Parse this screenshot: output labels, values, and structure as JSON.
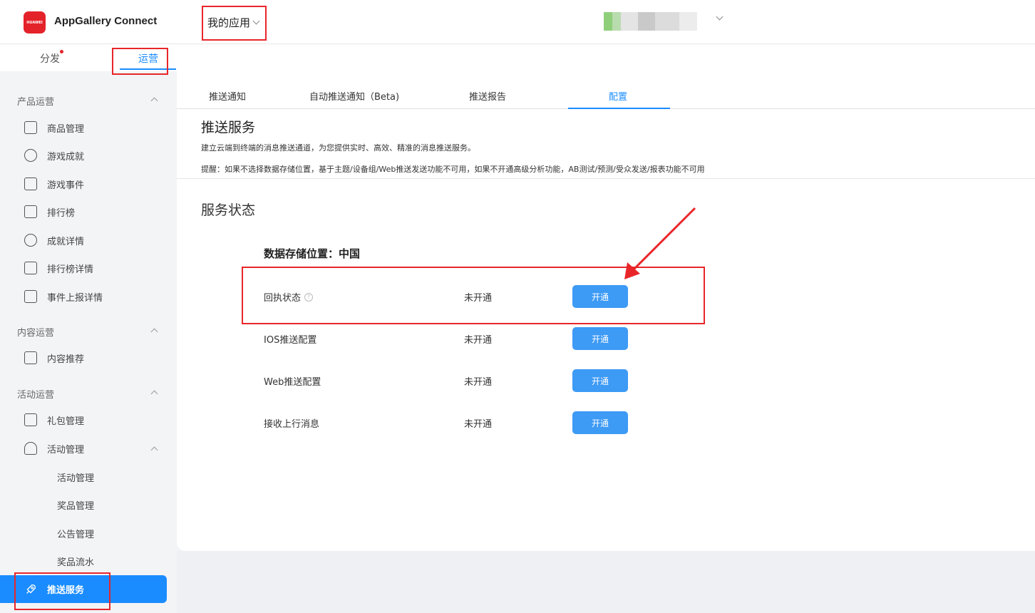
{
  "header": {
    "logo_text": "HUAWEI",
    "brand": "AppGallery Connect",
    "my_apps": "我的应用"
  },
  "subtabs": [
    {
      "label": "分发"
    },
    {
      "label": "运营"
    }
  ],
  "sidebar": {
    "sections": [
      {
        "title": "产品运营",
        "items": [
          "商品管理",
          "游戏成就",
          "游戏事件",
          "排行榜",
          "成就详情",
          "排行榜详情",
          "事件上报详情"
        ]
      },
      {
        "title": "内容运营",
        "items": [
          "内容推荐"
        ]
      },
      {
        "title": "活动运营",
        "items": [
          "礼包管理",
          "活动管理"
        ]
      }
    ],
    "activity_sub": [
      "活动管理",
      "奖品管理",
      "公告管理",
      "奖品流水"
    ],
    "active_item": "推送服务"
  },
  "main": {
    "tabs": [
      "推送通知",
      "自动推送通知（Beta)",
      "推送报告",
      "配置"
    ],
    "title": "推送服务",
    "description": "建立云端到终端的消息推送通道，为您提供实时、高效、精准的消息推送服务。",
    "tip": "提醒：如果不选择数据存储位置，基于主题/设备组/Web推送发送功能不可用，如果不开通高级分析功能，AB测试/预测/受众发送/报表功能不可用",
    "status_title": "服务状态",
    "storage_location": "数据存储位置：中国",
    "services": [
      {
        "name": "回执状态",
        "status": "未开通",
        "action": "开通"
      },
      {
        "name": "IOS推送配置",
        "status": "未开通",
        "action": "开通"
      },
      {
        "name": "Web推送配置",
        "status": "未开通",
        "action": "开通"
      },
      {
        "name": "接收上行消息",
        "status": "未开通",
        "action": "开通"
      }
    ],
    "help_icon": "?"
  },
  "colors": {
    "accent": "#1a8cff",
    "button": "#3d9af5",
    "annotation": "#e8262a",
    "brand_red": "#e4222a"
  }
}
